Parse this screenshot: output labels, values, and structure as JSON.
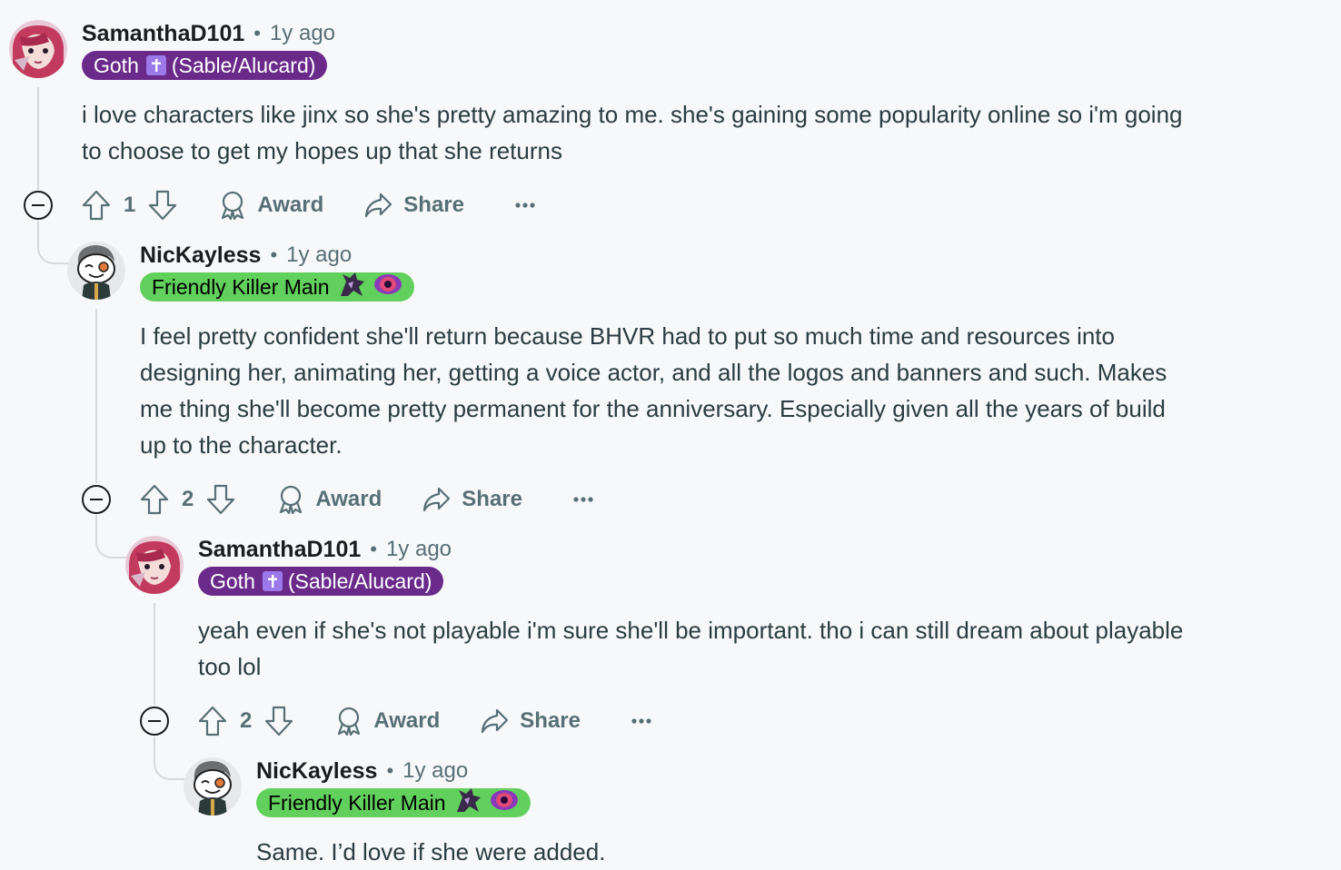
{
  "comments": [
    {
      "username": "SamanthaD101",
      "separator": "•",
      "timestamp": "1y ago",
      "flair": {
        "text_left": "Goth",
        "text_right": "(Sable/Alucard)",
        "style": "goth",
        "bg": "#6a2a8a"
      },
      "body_lines": [
        "i love characters like jinx so she's pretty amazing to me. she's gaining some popularity online so i'm going",
        "to choose to get my hopes up that she returns"
      ],
      "score": "1",
      "award_label": "Award",
      "share_label": "Share"
    },
    {
      "username": "NicKayless",
      "separator": "•",
      "timestamp": "1y ago",
      "flair": {
        "text": "Friendly Killer Main",
        "style": "killer",
        "bg": "#62d05c"
      },
      "body_lines": [
        "I feel pretty confident she'll return because BHVR had to put so much time and resources into",
        "designing her, animating her, getting a voice actor, and all the logos and banners and such. Makes",
        "me thing she'll become pretty permanent for the anniversary. Especially given all the years of build",
        "up to the character."
      ],
      "score": "2",
      "award_label": "Award",
      "share_label": "Share"
    },
    {
      "username": "SamanthaD101",
      "separator": "•",
      "timestamp": "1y ago",
      "flair": {
        "text_left": "Goth",
        "text_right": "(Sable/Alucard)",
        "style": "goth",
        "bg": "#6a2a8a"
      },
      "body_lines": [
        "yeah even if she's not playable i'm sure she'll be important. tho i can still dream about playable",
        "too lol"
      ],
      "score": "2",
      "award_label": "Award",
      "share_label": "Share"
    },
    {
      "username": "NicKayless",
      "separator": "•",
      "timestamp": "1y ago",
      "flair": {
        "text": "Friendly Killer Main",
        "style": "killer",
        "bg": "#62d05c"
      },
      "body_lines": [
        "Same. I’d love if she were added."
      ]
    }
  ],
  "icons": {
    "upvote": "arrow-up-outline-icon",
    "downvote": "arrow-down-outline-icon",
    "award": "award-ribbon-icon",
    "share": "share-arrow-icon",
    "more": "ellipsis-icon",
    "collapse": "collapse-minus-icon"
  },
  "colors": {
    "background": "#f7f8f9",
    "secondary_text": "#576f76",
    "goth_flair": "#6a2a8a",
    "killer_flair": "#62d05c"
  }
}
